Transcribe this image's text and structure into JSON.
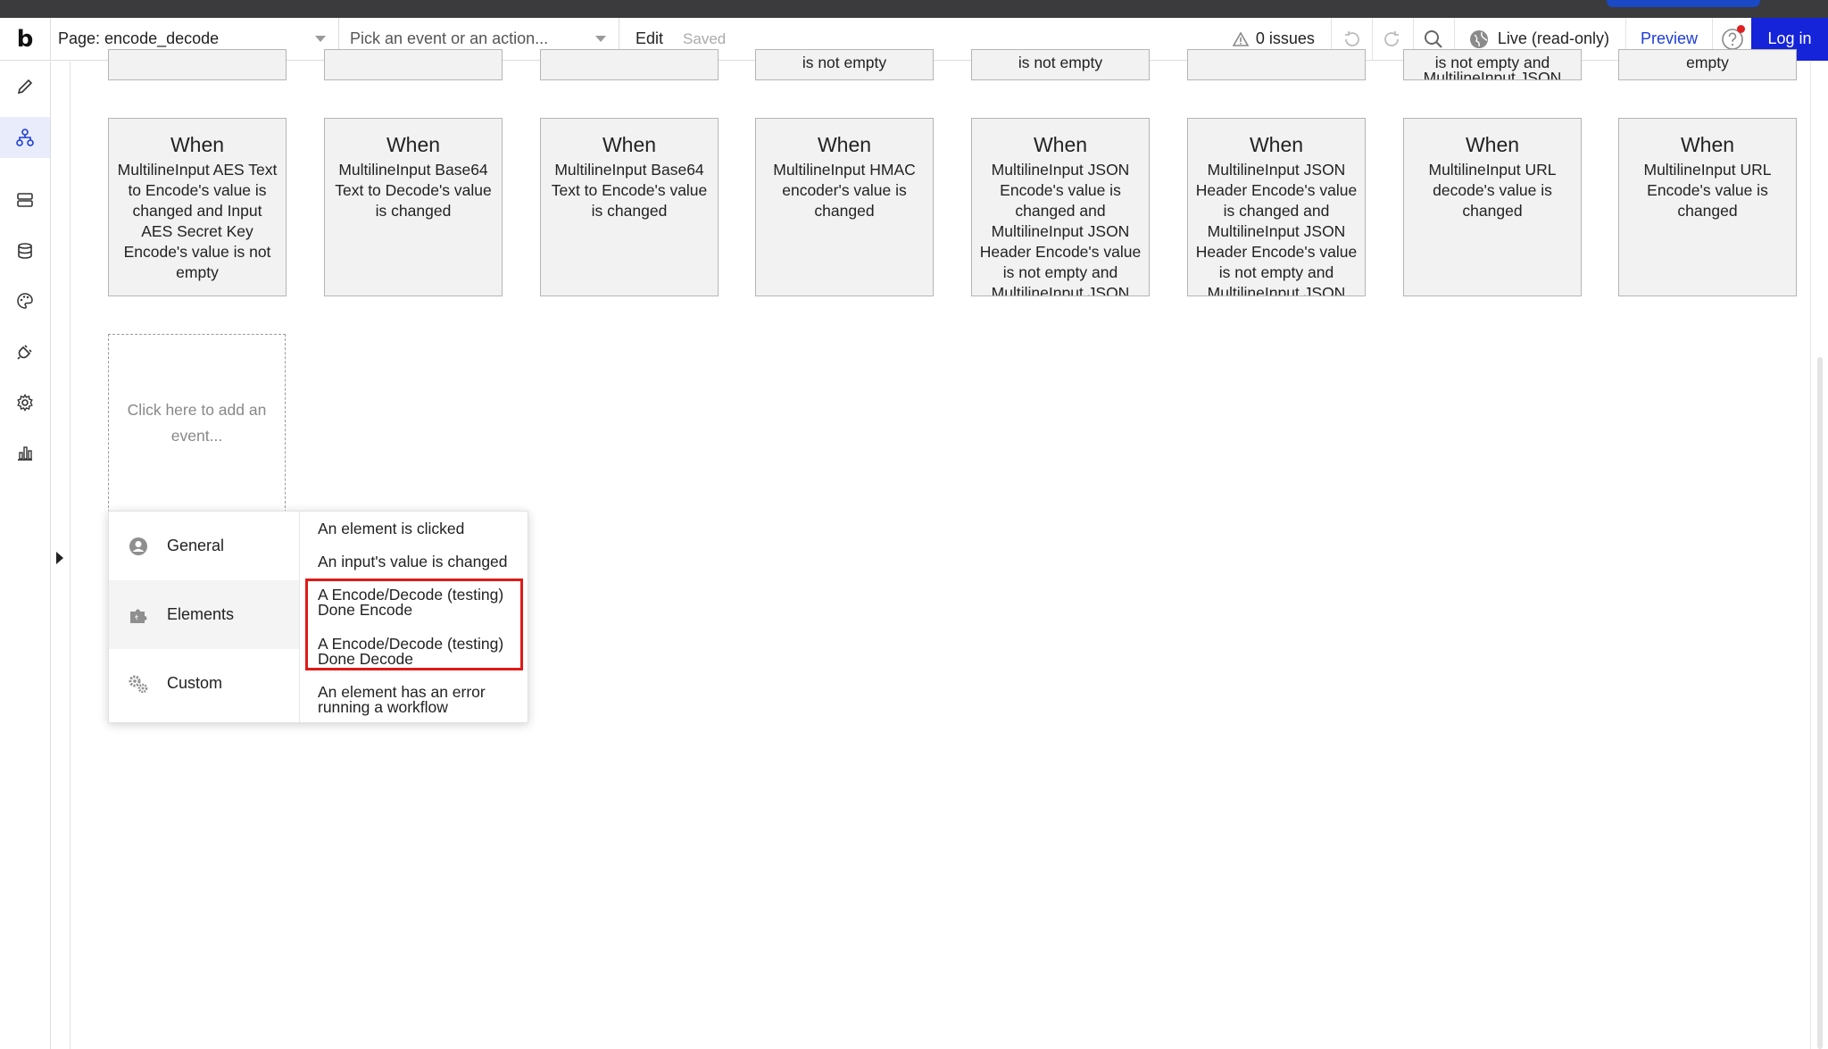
{
  "header": {
    "logo": "b",
    "page_label": "Page: encode_decode",
    "event_placeholder": "Pick an event or an action...",
    "edit_label": "Edit",
    "saved_label": "Saved",
    "issues_label": "0 issues",
    "live_label": "Live (read-only)",
    "preview_label": "Preview",
    "login_label": "Log in",
    "accent_color": "#1523d9"
  },
  "sidebar": {
    "items": [
      {
        "icon": "pencil-icon",
        "active": false
      },
      {
        "icon": "workflow-icon",
        "active": true
      },
      {
        "icon": "server-icon",
        "active": false
      },
      {
        "icon": "database-icon",
        "active": false
      },
      {
        "icon": "palette-icon",
        "active": false
      },
      {
        "icon": "plug-icon",
        "active": false
      },
      {
        "icon": "gear-icon",
        "active": false
      },
      {
        "icon": "chart-icon",
        "active": false
      }
    ]
  },
  "top_cards": [
    {
      "text": ""
    },
    {
      "text": ""
    },
    {
      "text": ""
    },
    {
      "text": "is not empty"
    },
    {
      "text": "is not empty"
    },
    {
      "text": ""
    },
    {
      "text": "is not empty and MultilineInput JSON"
    },
    {
      "text": "empty"
    }
  ],
  "cards": [
    {
      "when": "When",
      "condition": "MultilineInput AES Text to Encode's value is changed and Input AES Secret Key Encode's value is not empty"
    },
    {
      "when": "When",
      "condition": "MultilineInput Base64 Text to Decode's value is changed"
    },
    {
      "when": "When",
      "condition": "MultilineInput Base64 Text to Encode's value is changed"
    },
    {
      "when": "When",
      "condition": "MultilineInput HMAC encoder's value is changed"
    },
    {
      "when": "When",
      "condition": "MultilineInput JSON Encode's value is changed and MultilineInput JSON Header Encode's value is not empty and MultilineInput JSON"
    },
    {
      "when": "When",
      "condition": "MultilineInput JSON Header Encode's value is changed and MultilineInput JSON Header Encode's value is not empty and MultilineInput JSON"
    },
    {
      "when": "When",
      "condition": "MultilineInput URL decode's value is changed"
    },
    {
      "when": "When",
      "condition": "MultilineInput URL Encode's value is changed"
    }
  ],
  "add_event": {
    "label": "Click here to add an event..."
  },
  "menu": {
    "categories": [
      {
        "label": "General",
        "icon": "user-circle-icon"
      },
      {
        "label": "Elements",
        "icon": "puzzle-icon"
      },
      {
        "label": "Custom",
        "icon": "gears-icon"
      }
    ],
    "options": [
      {
        "label": "An element is clicked"
      },
      {
        "label": "An input's value is changed"
      },
      {
        "label_line1": "A Encode/Decode (testing)",
        "label_line2": "Done Encode"
      },
      {
        "label_line1": "A Encode/Decode (testing)",
        "label_line2": "Done Decode"
      },
      {
        "label_line1": "An element has an error",
        "label_line2": "running a workflow"
      }
    ]
  }
}
